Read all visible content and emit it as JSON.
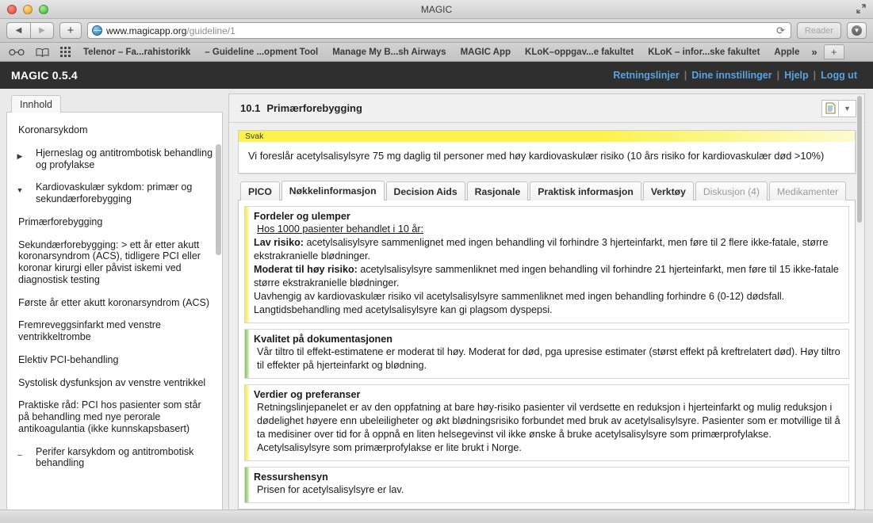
{
  "browser": {
    "window_title": "MAGIC",
    "url_domain": "www.magicapp.org",
    "url_path": "/guideline/1",
    "reload_icon": "reload-icon",
    "reader_label": "Reader",
    "download_icon": "download-icon",
    "back_icon": "back-arrow-icon",
    "forward_icon": "forward-arrow-icon",
    "new_tab_label": "+",
    "bookmark_icons": [
      "glasses-icon",
      "book-icon",
      "grid-icon"
    ],
    "bookmarks": [
      "Telenor – Fa...rahistorikk",
      "– Guideline ...opment Tool",
      "Manage My B...sh Airways",
      "MAGIC App",
      "KLoK–oppgav...e fakultet",
      "KLoK – infor...ske fakultet",
      "Apple"
    ],
    "bookmarks_overflow": "»",
    "tab_plus": "+"
  },
  "app": {
    "brand": "MAGIC 0.5.4",
    "nav": [
      {
        "label": "Retningslinjer"
      },
      {
        "label": "Dine innstillinger"
      },
      {
        "label": "Hjelp"
      },
      {
        "label": "Logg ut"
      }
    ],
    "nav_separator": "|",
    "accent_link_color": "#5aa2e0",
    "header_bg": "#2f2f2f"
  },
  "sidebar": {
    "tab_label": "Innhold",
    "tree": [
      {
        "label": "Koronarsykdom",
        "arrow": "",
        "depth": 0
      },
      {
        "label": "Hjerneslag og antitrombotisk behandling og profylakse",
        "arrow": "▶",
        "depth": 1
      },
      {
        "label": "Kardiovaskulær sykdom: primær og sekundærforebygging",
        "arrow": "▼",
        "depth": 1
      },
      {
        "label": "Primærforebygging",
        "arrow": "",
        "depth": 0
      },
      {
        "label": "Sekundærforebygging: > ett år etter akutt koronarsyndrom (ACS), tidligere PCI eller koronar kirurgi eller påvist iskemi ved diagnostisk testing",
        "arrow": "",
        "depth": 0
      },
      {
        "label": "Første år etter akutt koronarsyndrom (ACS)",
        "arrow": "",
        "depth": 0
      },
      {
        "label": "Fremreveggsinfarkt med venstre ventrikkeltrombe",
        "arrow": "",
        "depth": 0
      },
      {
        "label": "Elektiv PCI-behandling",
        "arrow": "",
        "depth": 0
      },
      {
        "label": "Systolisk dysfunksjon av venstre ventrikkel",
        "arrow": "",
        "depth": 0
      },
      {
        "label": "Praktiske råd: PCI hos pasienter som står på behandling med nye perorale antikoagulantia (ikke kunnskapsbasert)",
        "arrow": "",
        "depth": 0
      },
      {
        "label": "Perifer karsykdom og antitrombotisk behandling",
        "arrow": "−",
        "depth": 1
      }
    ]
  },
  "content": {
    "section_number": "10.1",
    "section_title": "Primærforebygging",
    "tools": [
      {
        "name": "document-icon"
      },
      {
        "name": "filter-dropdown-icon",
        "glyph": "▼"
      }
    ],
    "recommendation": {
      "strength_label": "Svak",
      "strength_color": "#fcf24a",
      "text": "Vi foreslår acetylsalisylsyre 75 mg daglig til personer med høy kardiovaskulær risiko (10 års risiko for kardiovaskulær død >10%)"
    },
    "tabs": [
      {
        "label": "PICO",
        "state": "normal"
      },
      {
        "label": "Nøkkelinformasjon",
        "state": "active"
      },
      {
        "label": "Decision Aids",
        "state": "normal"
      },
      {
        "label": "Rasjonale",
        "state": "normal"
      },
      {
        "label": "Praktisk informasjon",
        "state": "normal"
      },
      {
        "label": "Verktøy",
        "state": "normal"
      },
      {
        "label": "Diskusjon (4)",
        "state": "muted"
      },
      {
        "label": "Medikamenter",
        "state": "muted"
      }
    ],
    "sections": [
      {
        "accent": "yellow",
        "heading": "Fordeler og ulemper",
        "lead_underlined": "Hos 1000 pasienter behandlet i 10 år:",
        "lines": [
          {
            "bold": "Lav risiko:",
            "rest": " acetylsalisylsyre sammenlignet med ingen behandling vil forhindre 3 hjerteinfarkt, men føre til 2 flere ikke-fatale, større ekstrakranielle blødninger."
          },
          {
            "bold": "Moderat til høy risiko:",
            "rest": " acetylsalisylsyre sammenliknet med ingen behandling vil forhindre 21 hjerteinfarkt, men føre til 15 ikke-fatale større ekstrakranielle blødninger."
          },
          {
            "bold": "",
            "rest": "Uavhengig av kardiovaskulær risiko vil acetylsalisylsyre sammenliknet med ingen behandling forhindre 6 (0-12) dødsfall."
          },
          {
            "bold": "",
            "rest": "Langtidsbehandling med acetylsalisylsyre kan gi plagsom dyspepsi."
          }
        ]
      },
      {
        "accent": "green",
        "heading": "Kvalitet på dokumentasjonen",
        "body": "Vår tiltro til effekt-estimatene er moderat til høy. Moderat for død, pga upresise estimater (størst effekt på kreftrelatert død). Høy tiltro til effekter på hjerteinfarkt og blødning."
      },
      {
        "accent": "yellow",
        "heading": "Verdier og preferanser",
        "body": "Retningslinjepanelet er av den oppfatning at bare høy-risiko pasienter vil verdsette en reduksjon i hjerteinfarkt og mulig reduksjon i dødelighet høyere enn ubeleiligheter og økt blødningsrisiko forbundet med bruk av acetylsalisylsyre. Pasienter som er motvillige til å ta medisiner over tid for å oppnå en liten helsegevinst vil ikke ønske å bruke acetylsalisylsyre som primærprofylakse. Acetylsalisylsyre som primærprofylakse er lite brukt i Norge."
      },
      {
        "accent": "green",
        "heading": "Ressurshensyn",
        "body": "Prisen for acetylsalisylsyre er lav."
      }
    ]
  }
}
